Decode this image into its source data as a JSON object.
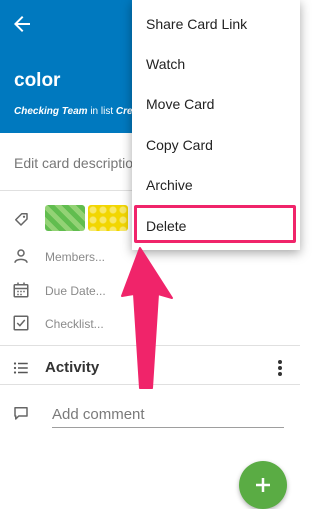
{
  "card": {
    "title": "color",
    "board": "Checking Team",
    "list_prefix": "in list",
    "list_name": "Crea",
    "description_placeholder": "Edit card description"
  },
  "fields": {
    "members": "Members...",
    "due_date": "Due Date...",
    "checklist": "Checklist..."
  },
  "activity": {
    "label": "Activity"
  },
  "comment": {
    "placeholder": "Add comment"
  },
  "menu": {
    "items": [
      "Share Card Link",
      "Watch",
      "Move Card",
      "Copy Card",
      "Archive",
      "Delete"
    ],
    "highlighted": "Delete"
  },
  "colors": {
    "header": "#0079bf",
    "fab": "#5aac44",
    "annotation": "#f0246a",
    "label_green": "#61bd4f",
    "label_yellow": "#f2d600"
  }
}
